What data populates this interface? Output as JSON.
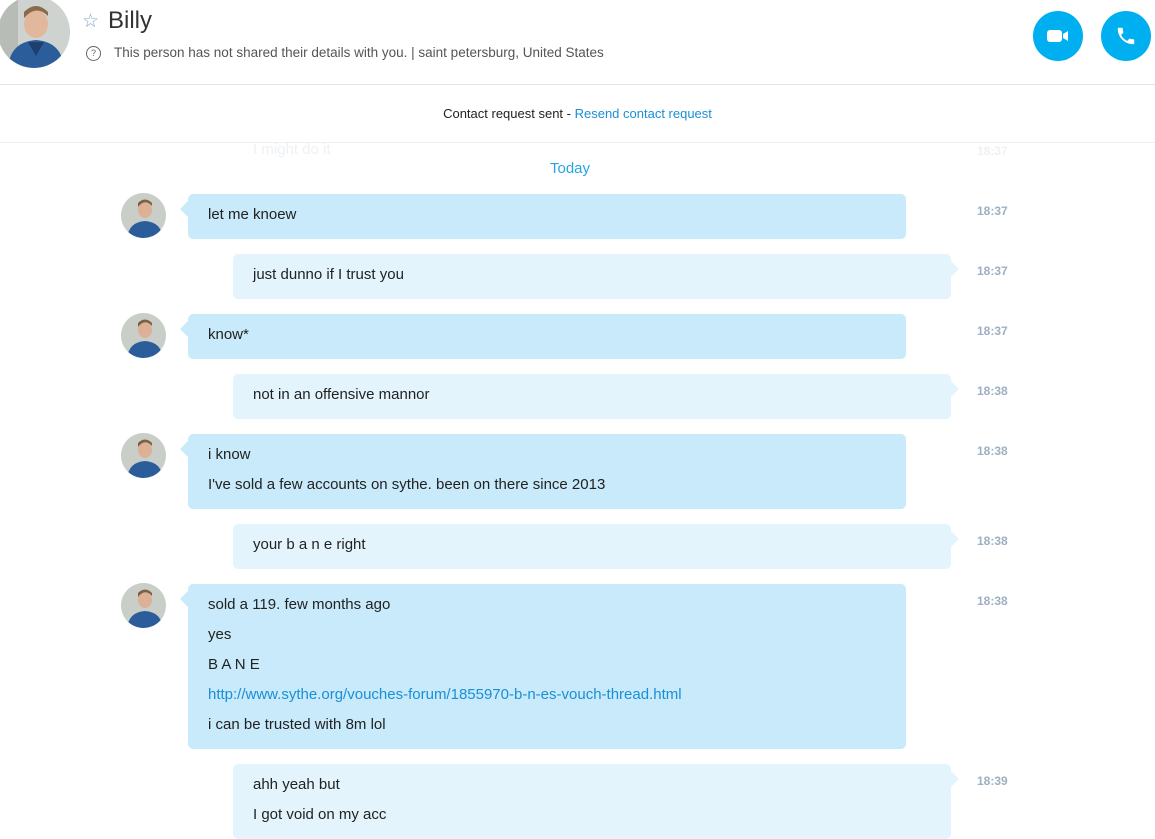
{
  "header": {
    "contact_name": "Billy",
    "details_text": "This person has not shared their details with you.  |  saint petersburg, United States"
  },
  "banner": {
    "status_text": "Contact request sent - ",
    "resend_link": "Resend contact request"
  },
  "conversation": {
    "faded_message": "I might do it",
    "faded_time": "18:37",
    "date_separator": "Today",
    "messages": [
      {
        "from": "Billy",
        "lines": [
          "let me knoew"
        ],
        "time": "18:37"
      },
      {
        "from": "me",
        "lines": [
          "just dunno if I trust you"
        ],
        "time": "18:37"
      },
      {
        "from": "Billy",
        "lines": [
          "know*"
        ],
        "time": "18:37"
      },
      {
        "from": "me",
        "lines": [
          "not in an  offensive mannor"
        ],
        "time": "18:38"
      },
      {
        "from": "Billy",
        "lines": [
          "i know",
          "I've sold a few accounts on sythe. been on there since 2013"
        ],
        "time": "18:38"
      },
      {
        "from": "me",
        "lines": [
          "your b a n e right"
        ],
        "time": "18:38"
      },
      {
        "from": "Billy",
        "lines": [
          "sold a 119. few months ago",
          "yes",
          "B A N E",
          "http://www.sythe.org/vouches-forum/1855970-b-n-es-vouch-thread.html",
          "i can be trusted with 8m lol"
        ],
        "time": "18:38"
      },
      {
        "from": "me",
        "lines": [
          "ahh yeah but",
          "I got void on my acc"
        ],
        "time": "18:39"
      }
    ]
  },
  "colors": {
    "accent": "#00aff0",
    "link": "#1a8fd6",
    "incoming_bubble": "#c8eafa",
    "outgoing_bubble": "#e4f4fd",
    "timestamp": "#9db0c2"
  }
}
